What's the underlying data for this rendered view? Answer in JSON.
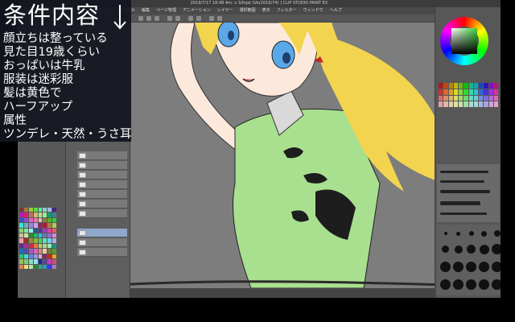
{
  "window": {
    "title": "2019/7/17 18:48 4m: x 3/frqst (Ver2016/74) ] CLIP STUDIO PAINT EX",
    "menu": [
      "ファイル",
      "編集",
      "ページ管理",
      "アニメーション",
      "レイヤー",
      "選択範囲",
      "表示",
      "フィルター",
      "ウィンドウ",
      "ヘルプ"
    ]
  },
  "overlay": {
    "title": "条件内容",
    "items": [
      "顔立ちは整っている",
      "見た目19歳くらい",
      "おっぱいは牛乳",
      "服装は迷彩服",
      "髪は黄色で",
      "ハーフアップ",
      "属性",
      "ツンデレ・天然・うさ耳"
    ]
  },
  "colors": {
    "hair": "#f2d44f",
    "eye": "#5aa8e8",
    "shirt": "#a9e08f",
    "camo": "#1d1d1d",
    "skin": "#fde9dc",
    "canvas_bg": "#7d7d7d"
  }
}
